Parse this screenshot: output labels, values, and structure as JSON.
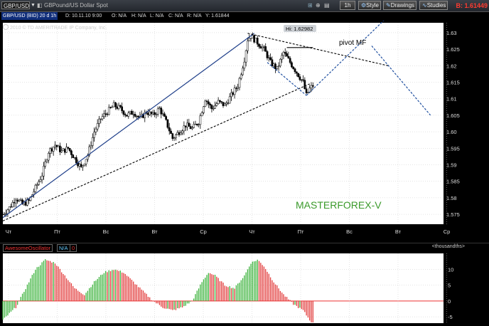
{
  "toolbar": {
    "symbol": "GBP/USD",
    "description": "GBPound/US Dollar Spot",
    "timeframe": "1h",
    "style_label": "Style",
    "drawings_label": "Drawings",
    "studies_label": "Studies",
    "last_price": "B: 1.61449"
  },
  "info": {
    "symbol_desc": "GBP/USD (BID) 20 d 1h",
    "date": "D: 10.11.10 9:00",
    "open": "O: N/A",
    "high": "H: N/A",
    "low": "L: N/A",
    "close": "C: N/A",
    "range": "R: N/A",
    "y": "Y: 1.61844",
    "copyright": "2010 © TD AMERITRADE IP Company, Inc."
  },
  "annotations": {
    "high_label": "Hi: 1.62982",
    "pivot_label": "pivot MF",
    "watermark": "MASTERFOREX-V"
  },
  "oscillator": {
    "name": "AwesomeOscillator",
    "value": "N/A",
    "units": "<thousandths>"
  },
  "chart_data": [
    {
      "type": "candlestick",
      "title": "GBP/USD (BID) 20 d 1h",
      "ylim": [
        1.572,
        1.633
      ],
      "y_ticks": [
        1.575,
        1.58,
        1.585,
        1.59,
        1.595,
        1.6,
        1.605,
        1.61,
        1.615,
        1.62,
        1.625,
        1.63
      ],
      "x_tick_labels": [
        "Чт",
        "Пт",
        "Вс",
        "Вт",
        "Ср",
        "Чт",
        "Пт",
        "Вс",
        "Вт",
        "Ср"
      ],
      "grid": true,
      "close_path": [
        [
          0,
          1.575
        ],
        [
          4,
          1.577
        ],
        [
          8,
          1.58
        ],
        [
          12,
          1.578
        ],
        [
          16,
          1.579
        ],
        [
          20,
          1.583
        ],
        [
          24,
          1.587
        ],
        [
          28,
          1.594
        ],
        [
          32,
          1.596
        ],
        [
          36,
          1.594
        ],
        [
          40,
          1.595
        ],
        [
          44,
          1.592
        ],
        [
          48,
          1.589
        ],
        [
          52,
          1.593
        ],
        [
          56,
          1.6
        ],
        [
          60,
          1.604
        ],
        [
          64,
          1.606
        ],
        [
          68,
          1.608
        ],
        [
          72,
          1.607
        ],
        [
          76,
          1.605
        ],
        [
          80,
          1.606
        ],
        [
          84,
          1.604
        ],
        [
          88,
          1.606
        ],
        [
          92,
          1.605
        ],
        [
          96,
          1.607
        ],
        [
          100,
          1.603
        ],
        [
          104,
          1.598
        ],
        [
          108,
          1.6
        ],
        [
          112,
          1.602
        ],
        [
          116,
          1.601
        ],
        [
          120,
          1.603
        ],
        [
          124,
          1.61
        ],
        [
          128,
          1.607
        ],
        [
          132,
          1.609
        ],
        [
          136,
          1.608
        ],
        [
          140,
          1.611
        ],
        [
          144,
          1.614
        ],
        [
          148,
          1.622
        ],
        [
          150,
          1.628
        ],
        [
          152,
          1.629
        ],
        [
          156,
          1.627
        ],
        [
          160,
          1.625
        ],
        [
          164,
          1.621
        ],
        [
          168,
          1.619
        ],
        [
          172,
          1.624
        ],
        [
          176,
          1.621
        ],
        [
          180,
          1.618
        ],
        [
          184,
          1.615
        ],
        [
          186,
          1.611
        ],
        [
          188,
          1.613
        ],
        [
          190,
          1.614
        ]
      ]
    },
    {
      "type": "bar",
      "title": "AwesomeOscillator",
      "ylim": [
        -7,
        15
      ],
      "y_ticks": [
        -5,
        0,
        5,
        10
      ],
      "values_path": [
        [
          0,
          -6
        ],
        [
          8,
          -2
        ],
        [
          14,
          4
        ],
        [
          20,
          10
        ],
        [
          26,
          13
        ],
        [
          32,
          12
        ],
        [
          38,
          8
        ],
        [
          44,
          4
        ],
        [
          50,
          2
        ],
        [
          56,
          6
        ],
        [
          62,
          9
        ],
        [
          68,
          10
        ],
        [
          74,
          9
        ],
        [
          80,
          6
        ],
        [
          86,
          3
        ],
        [
          92,
          0
        ],
        [
          98,
          -2
        ],
        [
          104,
          -3
        ],
        [
          110,
          -2
        ],
        [
          116,
          0
        ],
        [
          122,
          6
        ],
        [
          126,
          9
        ],
        [
          130,
          8
        ],
        [
          136,
          5
        ],
        [
          142,
          4
        ],
        [
          148,
          8
        ],
        [
          152,
          12
        ],
        [
          156,
          13
        ],
        [
          160,
          11
        ],
        [
          166,
          6
        ],
        [
          172,
          2
        ],
        [
          178,
          -1
        ],
        [
          184,
          -3
        ],
        [
          188,
          -6
        ],
        [
          190,
          -7
        ]
      ]
    }
  ]
}
